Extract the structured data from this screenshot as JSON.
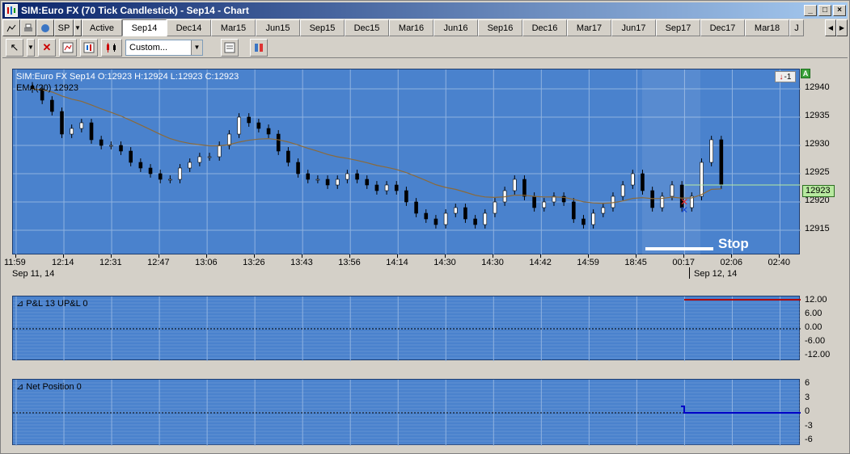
{
  "window": {
    "title": "SIM:Euro FX (70 Tick Candlestick) - Sep14 - Chart",
    "min": "_",
    "max": "□",
    "close": "×"
  },
  "tabbar": {
    "instrument": "SP",
    "tabs": [
      "Active",
      "Sep14",
      "Dec14",
      "Mar15",
      "Jun15",
      "Sep15",
      "Dec15",
      "Mar16",
      "Jun16",
      "Sep16",
      "Dec16",
      "Mar17",
      "Jun17",
      "Sep17",
      "Dec17",
      "Mar18",
      "J"
    ],
    "selected": "Sep14"
  },
  "toolbar": {
    "combo_value": "Custom..."
  },
  "price_panel": {
    "legend_line1": "SIM:Euro FX Sep14 O:12923 H:12924 L:12923 C:12923",
    "legend_line2": "EMA(20)  12923",
    "badge": "A",
    "pos_marker": "-1",
    "stop_label": "Stop",
    "last_price": "12923",
    "yticks": [
      "12940",
      "12935",
      "12930",
      "12925",
      "12920",
      "12915"
    ],
    "xticks": [
      "11:59",
      "12:14",
      "12:31",
      "12:47",
      "13:06",
      "13:26",
      "13:43",
      "13:56",
      "14:14",
      "14:30",
      "14:30",
      "14:42",
      "14:59",
      "18:45",
      "00:17",
      "02:06",
      "02:40"
    ],
    "date_left": "Sep 11, 14",
    "date_right": "Sep 12, 14"
  },
  "pnl_panel": {
    "label": "P&L  13   UP&L  0",
    "yticks": [
      "12.00",
      "6.00",
      "0.00",
      "-6.00",
      "-12.00"
    ]
  },
  "pos_panel": {
    "label": "Net Position  0",
    "yticks": [
      "6",
      "3",
      "0",
      "-3",
      "-6"
    ]
  },
  "colors": {
    "panel_bg": "#4a82cd",
    "grid": "#8fb2e0",
    "ema": "#8b6a3a",
    "pnl_line": "#b00000",
    "position_line": "#0000c8",
    "last_price_bg": "#b7e99f"
  },
  "chart_data": {
    "type": "candlestick",
    "title": "SIM:Euro FX (70 Tick Candlestick) - Sep14",
    "ylim": [
      12912,
      12942
    ],
    "close_series": [
      12940,
      12938,
      12936,
      12932,
      12933,
      12934,
      12931,
      12930,
      12930,
      12929,
      12927,
      12926,
      12925,
      12924,
      12924,
      12926,
      12927,
      12928,
      12928,
      12930,
      12932,
      12935,
      12934,
      12933,
      12932,
      12929,
      12927,
      12925,
      12924,
      12924,
      12923,
      12924,
      12925,
      12924,
      12923,
      12922,
      12923,
      12922,
      12920,
      12918,
      12917,
      12916,
      12918,
      12919,
      12917,
      12916,
      12918,
      12920,
      12922,
      12924,
      12921,
      12919,
      12920,
      12921,
      12920,
      12917,
      12916,
      12918,
      12919,
      12921,
      12923,
      12925,
      12922,
      12919,
      12921,
      12923,
      12919,
      12921,
      12927,
      12931,
      12923
    ],
    "ema_value": 12923,
    "pnl": 13,
    "unrealized_pnl": 0,
    "net_position": 0
  }
}
